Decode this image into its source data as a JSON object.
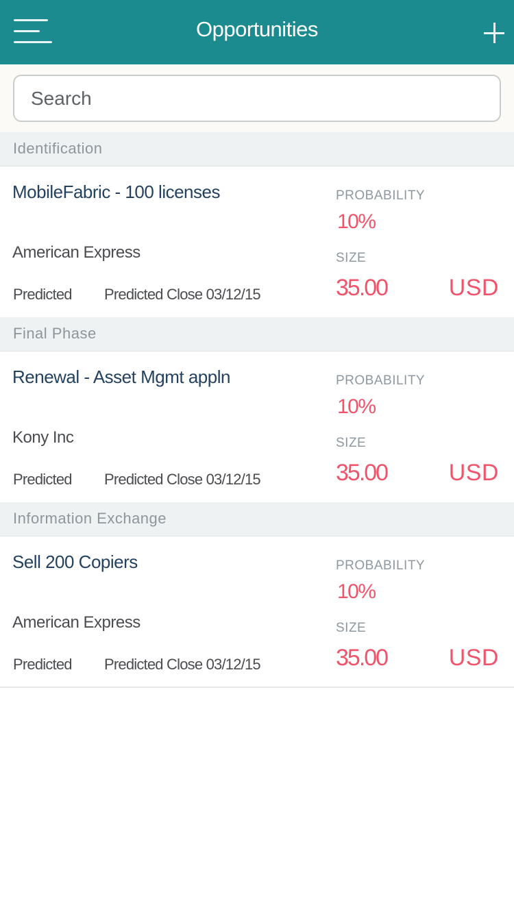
{
  "header": {
    "title": "Opportunities",
    "menu_icon": "hamburger-menu-icon",
    "add_icon": "plus-icon"
  },
  "search": {
    "placeholder": "Search",
    "value": ""
  },
  "labels": {
    "probability": "PROBABILITY",
    "size": "SIZE"
  },
  "opportunities": [
    {
      "stage": "Identification",
      "name": "MobileFabric - 100 licenses",
      "account": "American Express",
      "forecast": "Predicted",
      "close": "Predicted Close 03/12/15",
      "probability": "10%",
      "size": "35.00",
      "currency": "USD"
    },
    {
      "stage": "Final Phase",
      "name": "Renewal - Asset Mgmt appln",
      "account": "Kony Inc",
      "forecast": "Predicted",
      "close": "Predicted Close 03/12/15",
      "probability": "10%",
      "size": "35.00",
      "currency": "USD"
    },
    {
      "stage": "Information Exchange",
      "name": "Sell 200 Copiers",
      "account": "American Express",
      "forecast": "Predicted",
      "close": "Predicted Close 03/12/15",
      "probability": "10%",
      "size": "35.00",
      "currency": "USD"
    }
  ],
  "colors": {
    "header_bg": "#1b8b90",
    "accent": "#f0546b",
    "title_text": "#24425f",
    "section_bg": "#eef2f3"
  }
}
